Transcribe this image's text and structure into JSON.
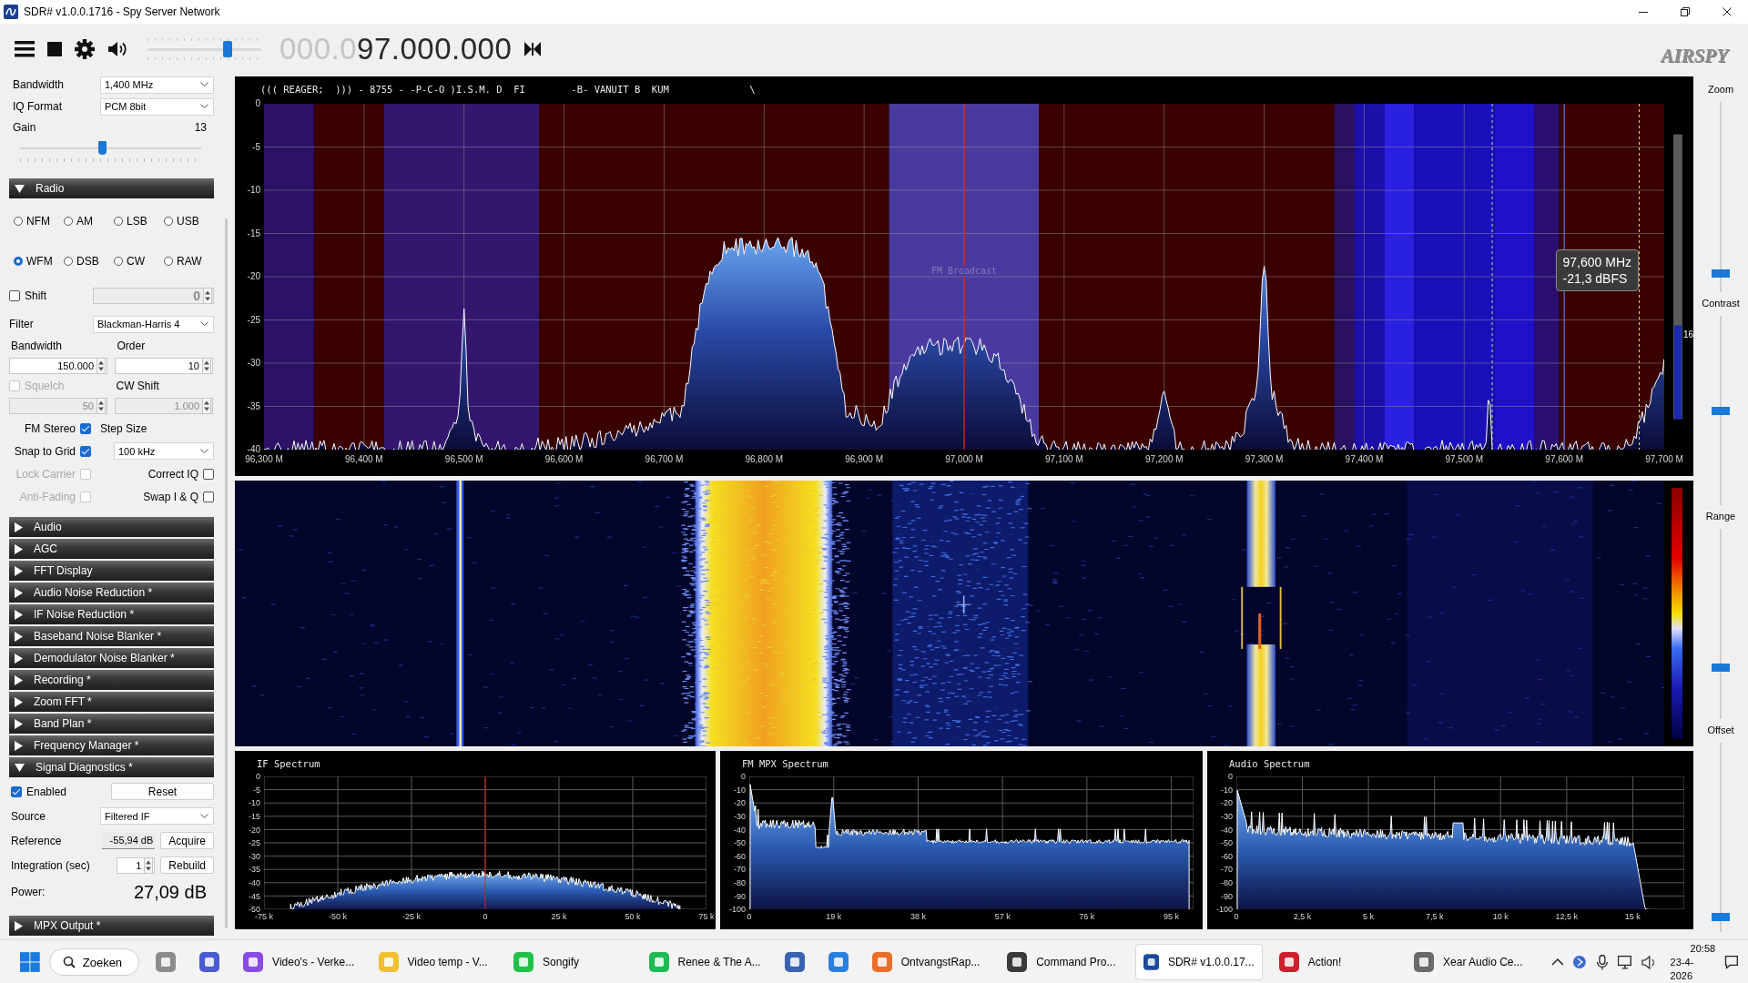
{
  "window": {
    "title": "SDR# v1.0.0.1716 - Spy Server Network"
  },
  "toolbar": {
    "frequency_dim": "000.0",
    "frequency": "97.000.000",
    "volume": {
      "level": 0.7
    },
    "logo": "AIRSPY"
  },
  "source": {
    "fields": [
      {
        "label": "Bandwidth",
        "value": "1,400 MHz"
      },
      {
        "label": "IQ Format",
        "value": "PCM 8bit"
      }
    ],
    "gain": {
      "label": "Gain",
      "reading": "13",
      "level": 0.45
    }
  },
  "radio": {
    "title": "Radio",
    "expanded": true,
    "modes": [
      {
        "label": "NFM",
        "selected": false
      },
      {
        "label": "AM",
        "selected": false
      },
      {
        "label": "LSB",
        "selected": false
      },
      {
        "label": "USB",
        "selected": false
      },
      {
        "label": "WFM",
        "selected": true
      },
      {
        "label": "DSB",
        "selected": false
      },
      {
        "label": "CW",
        "selected": false
      },
      {
        "label": "RAW",
        "selected": false
      }
    ],
    "shift": {
      "label": "Shift",
      "checked": false,
      "value": "0",
      "disabled": true
    },
    "filter": {
      "label": "Filter",
      "value": "Blackman-Harris 4"
    },
    "bandwidth": {
      "label": "Bandwidth",
      "value": "150.000"
    },
    "order": {
      "label": "Order",
      "value": "10"
    },
    "squelch": {
      "label": "Squelch",
      "checked": false,
      "disabled": true,
      "value": "50"
    },
    "cw_shift": {
      "label": "CW Shift",
      "value": "1.000",
      "disabled": true
    },
    "step_size": {
      "label": "Step Size",
      "value": "100 kHz"
    },
    "options_left": [
      {
        "label": "FM Stereo",
        "checked": true,
        "disabled": false
      },
      {
        "label": "Snap to Grid",
        "checked": true,
        "disabled": false
      },
      {
        "label": "Lock Carrier",
        "checked": false,
        "disabled": true
      },
      {
        "label": "Anti-Fading",
        "checked": false,
        "disabled": true
      }
    ],
    "options_right": [
      {
        "label": "Correct IQ",
        "checked": false
      },
      {
        "label": "Swap I & Q",
        "checked": false
      }
    ]
  },
  "plugins": [
    {
      "kind": "header",
      "title": "Audio",
      "expanded": false
    },
    {
      "kind": "header",
      "title": "AGC",
      "expanded": false
    },
    {
      "kind": "header",
      "title": "FFT Display",
      "expanded": false
    },
    {
      "kind": "header",
      "title": "Audio Noise Reduction *",
      "expanded": false
    },
    {
      "kind": "header",
      "title": "IF Noise Reduction *",
      "expanded": false
    },
    {
      "kind": "header",
      "title": "Baseband Noise Blanker *",
      "expanded": false
    },
    {
      "kind": "header",
      "title": "Demodulator Noise Blanker *",
      "expanded": false
    },
    {
      "kind": "header",
      "title": "Recording *",
      "expanded": false
    },
    {
      "kind": "header",
      "title": "Zoom FFT *",
      "expanded": false
    },
    {
      "kind": "header",
      "title": "Band Plan *",
      "expanded": false
    },
    {
      "kind": "header",
      "title": "Frequency Manager *",
      "expanded": false
    },
    {
      "kind": "diagnostics",
      "title": "Signal Diagnostics *",
      "expanded": true,
      "enabled": {
        "label": "Enabled",
        "checked": true
      },
      "reset": "Reset",
      "source": {
        "label": "Source",
        "value": "Filtered IF"
      },
      "reference": {
        "label": "Reference",
        "value": "-55,94 dB",
        "button": "Acquire"
      },
      "integration": {
        "label": "Integration (sec)",
        "value": "1",
        "button": "Rebuild"
      },
      "power": {
        "label": "Power:",
        "value": "27,09 dB"
      }
    },
    {
      "kind": "header",
      "title": "MPX Output *",
      "expanded": false
    }
  ],
  "spectrum": {
    "rds_text": "((( REAGER;  ))) - 8755 - -P-C-O )I.S.M. D  FI        -B- VANUIT B  KUM              \\",
    "y_labels": [
      "0",
      "-5",
      "-10",
      "-15",
      "-20",
      "-25",
      "-30",
      "-35",
      "-40"
    ],
    "x_labels": [
      "96,300 M",
      "96,400 M",
      "96,500 M",
      "96,600 M",
      "96,700 M",
      "96,800 M",
      "96,900 M",
      "97,000 M",
      "97,100 M",
      "97,200 M",
      "97,300 M",
      "97,400 M",
      "97,500 M",
      "97,600 M",
      "97,700 M"
    ],
    "band_label": "FM Broadcast",
    "tooltip": [
      "97,600 MHz",
      "-21,3 dBFS"
    ],
    "scale_label": "16"
  },
  "side_controls": [
    {
      "label": "Zoom",
      "level": 0.1
    },
    {
      "label": "Contrast",
      "level": 0.5
    },
    {
      "label": "Range",
      "level": 0.27
    },
    {
      "label": "Offset",
      "level": 0.08
    }
  ],
  "small_spectra": [
    {
      "kind": "if",
      "title": "IF Spectrum",
      "y_labels": [
        "0",
        "-5",
        "-10",
        "-15",
        "-20",
        "-25",
        "-30",
        "-35",
        "-40",
        "-45",
        "-50"
      ],
      "x_labels": [
        "-75 k",
        "-50 k",
        "-25 k",
        "0",
        "25 k",
        "50 k",
        "75 k"
      ]
    },
    {
      "kind": "mpx",
      "title": "FM MPX Spectrum",
      "y_labels": [
        "0",
        "-10",
        "-20",
        "-30",
        "-40",
        "-50",
        "-60",
        "-70",
        "-80",
        "-90",
        "-100"
      ],
      "x_labels": [
        "0",
        "19 k",
        "38 k",
        "57 k",
        "76 k",
        "95 k"
      ]
    },
    {
      "kind": "audio",
      "title": "Audio Spectrum",
      "y_labels": [
        "0",
        "-10",
        "-20",
        "-30",
        "-40",
        "-50",
        "-60",
        "-70",
        "-80",
        "-90",
        "-100"
      ],
      "x_labels": [
        "0",
        "2,5 k",
        "5 k",
        "7,5 k",
        "10 k",
        "12,5 k",
        "15 k"
      ]
    }
  ],
  "taskbar": {
    "search": "Zoeken",
    "items": [
      {
        "color": "#8c8c8c",
        "selected": false
      },
      {
        "color": "#4a5ad0",
        "selected": false
      },
      {
        "label": "Video's - Verke...",
        "color": "#8a4ce0",
        "selected": false
      },
      {
        "label": "Video temp - V...",
        "color": "#f0c030",
        "selected": false
      },
      {
        "label": "Songify",
        "color": "#22c04a",
        "selected": false
      },
      {
        "label": "Renee & The A...",
        "color": "#1db954",
        "selected": false
      },
      {
        "color": "#3a62b0",
        "selected": false
      },
      {
        "color": "#2a80e0",
        "selected": false
      },
      {
        "label": "OntvangstRap...",
        "color": "#e8702a",
        "selected": false
      },
      {
        "label": "Command Pro...",
        "color": "#3a3a3a",
        "selected": false
      },
      {
        "label": "SDR# v1.0.0.17...",
        "color": "#1a4a9a",
        "selected": true
      },
      {
        "label": "Action!",
        "color": "#d02030",
        "selected": false
      },
      {
        "label": "Xear Audio Ce...",
        "color": "#6a6a6a",
        "selected": false
      }
    ],
    "time": "20:58",
    "date": "23-4-2026"
  }
}
